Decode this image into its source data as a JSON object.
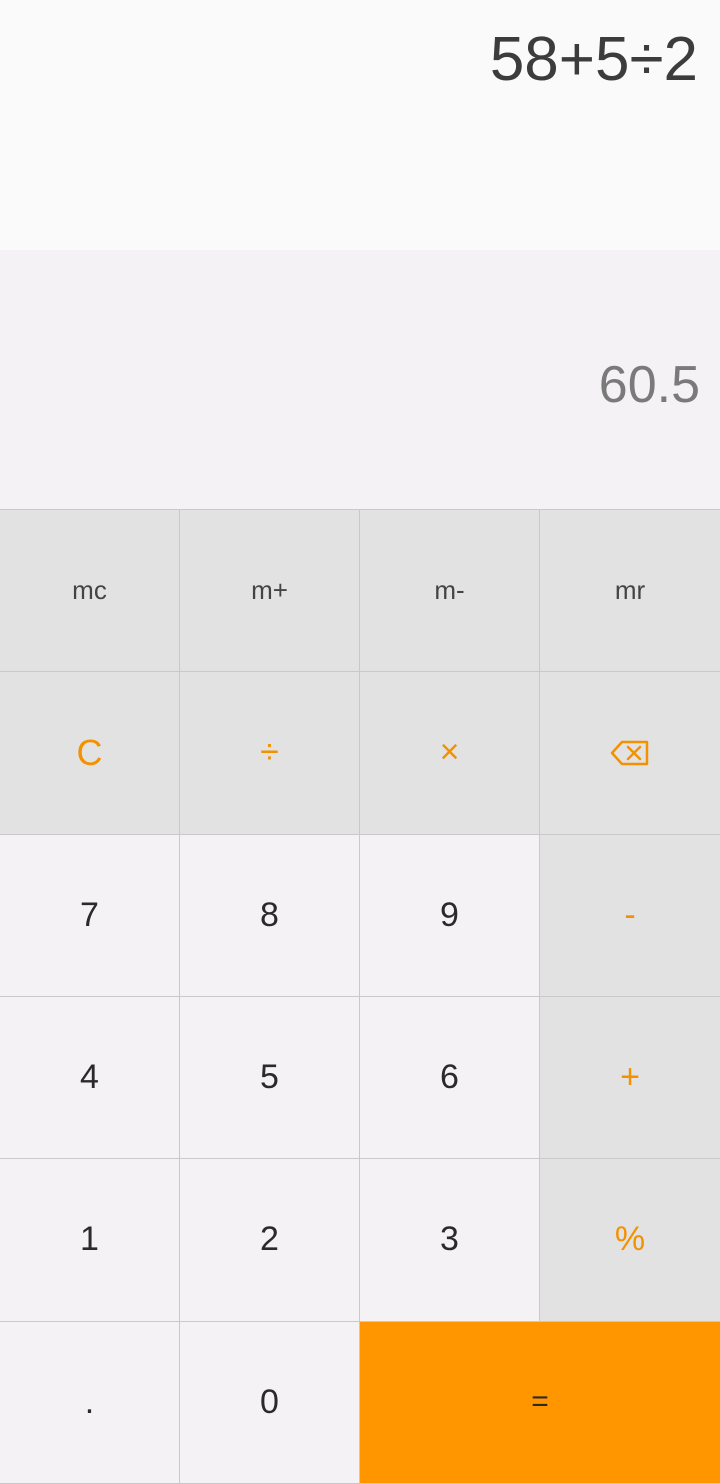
{
  "display": {
    "expression": "58+5÷2",
    "result": "60.5"
  },
  "keys": {
    "mc": "mc",
    "m_plus": "m+",
    "m_minus": "m-",
    "mr": "mr",
    "clear": "C",
    "divide": "÷",
    "multiply": "×",
    "backspace_icon": "backspace-icon",
    "seven": "7",
    "eight": "8",
    "nine": "9",
    "minus": "-",
    "four": "4",
    "five": "5",
    "six": "6",
    "plus": "+",
    "one": "1",
    "two": "2",
    "three": "3",
    "percent": "%",
    "dot": ".",
    "zero": "0",
    "equals": "="
  },
  "colors": {
    "accent": "#ff9600",
    "operator_text": "#f39200",
    "function_key_bg": "#e3e2e2",
    "digit_key_bg": "#f4f2f4",
    "expression_bg": "#fafafa"
  }
}
